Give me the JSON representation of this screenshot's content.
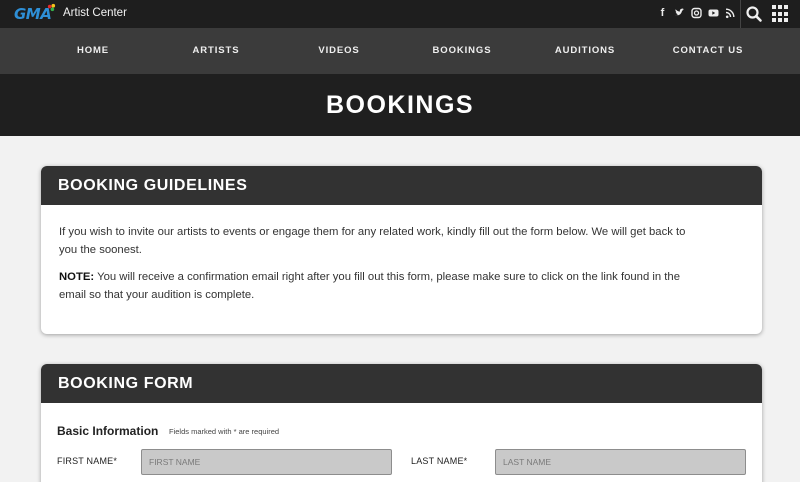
{
  "topbar": {
    "logo": "GMA",
    "brand": "Artist Center",
    "social": [
      {
        "name": "facebook-icon",
        "glyph": "f"
      },
      {
        "name": "twitter-icon",
        "glyph": "t"
      },
      {
        "name": "instagram-icon",
        "glyph": "◎"
      },
      {
        "name": "youtube-icon",
        "glyph": "▶"
      },
      {
        "name": "rss-icon",
        "glyph": "◝"
      }
    ]
  },
  "nav": {
    "items": [
      "HOME",
      "ARTISTS",
      "VIDEOS",
      "BOOKINGS",
      "AUDITIONS",
      "CONTACT US"
    ],
    "active": "BOOKINGS"
  },
  "hero": {
    "title": "BOOKINGS"
  },
  "guidelines": {
    "title": "BOOKING GUIDELINES",
    "paragraph": "If you wish to invite our artists to events or engage them for any related work, kindly fill out the form below. We will get back to you the soonest.",
    "note_label": "NOTE:",
    "note_text": " You will receive a confirmation email right after you fill out this form, please make sure to click on the link found in the email so that your audition is complete."
  },
  "form": {
    "title": "BOOKING FORM",
    "section_title": "Basic Information",
    "section_note": "Fields marked with * are required",
    "first_name_label": "FIRST NAME*",
    "first_name_placeholder": "FIRST NAME",
    "last_name_label": "LAST NAME*",
    "last_name_placeholder": "LAST NAME"
  },
  "colors": {
    "topbar": "#1e1e1e",
    "navbar": "#3b3b3b",
    "hero": "#1f1f1f",
    "card_header": "#323232",
    "logo_blue": "#2e8fd6"
  }
}
